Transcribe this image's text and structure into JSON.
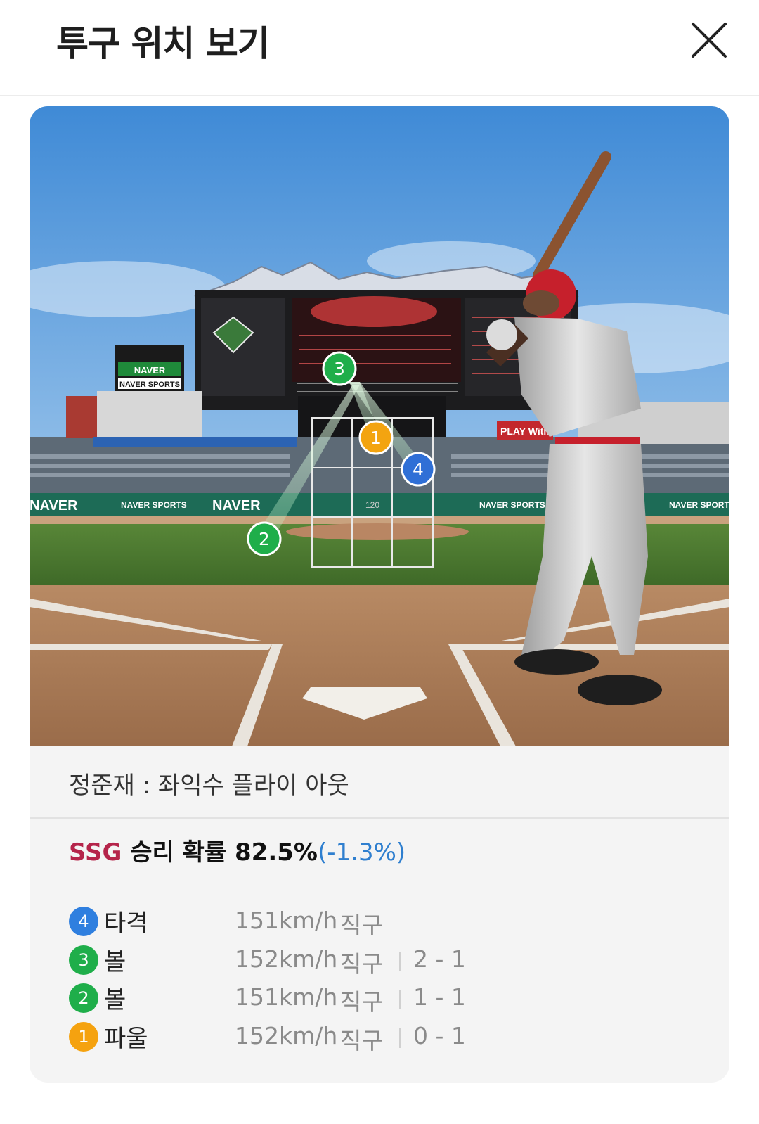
{
  "header": {
    "title": "투구 위치 보기",
    "close_icon": "close-icon"
  },
  "scene": {
    "board_brand": "NAVER",
    "board_sub": "NAVER SPORTS",
    "wall_texts": [
      "NAVER",
      "NAVER SPORTS",
      "NAVER",
      "NAVER SPORTS",
      "NAVER SPORTS"
    ],
    "ad_text": "PLAY With",
    "speed_readout": "120",
    "markers": [
      {
        "num": "3",
        "color": "#1fae4a"
      },
      {
        "num": "1",
        "color": "#f3a410"
      },
      {
        "num": "4",
        "color": "#2f6fd6"
      },
      {
        "num": "2",
        "color": "#1fae4a"
      }
    ]
  },
  "result": {
    "text": "정준재 : 좌익수 플라이 아웃"
  },
  "probability": {
    "team": "SSG",
    "label": " 승리 확률 ",
    "value": "82.5%",
    "delta": "(-1.3%)"
  },
  "pitches": [
    {
      "num": "4",
      "color": "#2f7fdf",
      "type": "타격",
      "speed": "151km/h",
      "kind": "직구",
      "count": ""
    },
    {
      "num": "3",
      "color": "#1fae4a",
      "type": "볼",
      "speed": "152km/h",
      "kind": "직구",
      "count": "2 - 1"
    },
    {
      "num": "2",
      "color": "#1fae4a",
      "type": "볼",
      "speed": "151km/h",
      "kind": "직구",
      "count": "1 - 1"
    },
    {
      "num": "1",
      "color": "#f5a20f",
      "type": "파울",
      "speed": "152km/h",
      "kind": "직구",
      "count": "0 - 1"
    }
  ]
}
